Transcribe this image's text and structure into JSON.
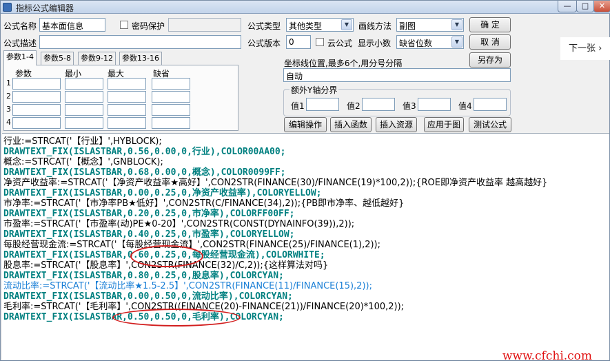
{
  "window": {
    "title": "指标公式编辑器",
    "minimize": "—",
    "maximize": "□",
    "close": "✕"
  },
  "form": {
    "name_label": "公式名称",
    "name_value": "基本面信息",
    "password_label": "密码保护",
    "desc_label": "公式描述",
    "desc_value": "",
    "type_label": "公式类型",
    "type_value": "其他类型",
    "draw_label": "画线方法",
    "draw_value": "副图",
    "version_label": "公式版本",
    "version_value": "0",
    "cloud_label": "云公式",
    "decimals_label": "显示小数",
    "decimals_value": "缺省位数"
  },
  "buttons": {
    "confirm": "确  定",
    "cancel": "取  消",
    "save_as": "另存为",
    "edit_op": "编辑操作",
    "insert_func": "插入函数",
    "insert_res": "插入资源",
    "apply_chart": "应用于图",
    "test_formula": "测试公式"
  },
  "tabs": [
    "参数1-4",
    "参数5-8",
    "参数9-12",
    "参数13-16"
  ],
  "params": {
    "col_param": "参数",
    "col_min": "最小",
    "col_max": "最大",
    "col_default": "缺省",
    "rows": [
      "1",
      "2",
      "3",
      "4"
    ]
  },
  "coord": {
    "label": "坐标线位置,最多6个,用分号分隔",
    "value": "自动"
  },
  "yaxis": {
    "legend": "额外Y轴分界",
    "v1": "值1",
    "v2": "值2",
    "v3": "值3",
    "v4": "值4"
  },
  "next_page": "下一张 ›",
  "code_lines": [
    "行业:=STRCAT('【行业】',HYBLOCK);",
    "DRAWTEXT_FIX(ISLASTBAR,0.56,0.00,0,行业),COLOR00AA00;",
    "概念:=STRCAT('【概念】',GNBLOCK);",
    "DRAWTEXT_FIX(ISLASTBAR,0.68,0.00,0,概念),COLOR0099FF;",
    "净资产收益率:=STRCAT('【净资产收益率★高好】',CON2STR(FINANCE(30)/FINANCE(19)*100,2));{ROE即净资产收益率 越高越好}",
    "DRAWTEXT_FIX(ISLASTBAR,0.00,0.25,0,净资产收益率),COLORYELLOW;",
    "市净率:=STRCAT('【市净率PB★低好】',CON2STR(C/FINANCE(34),2));{PB即市净率、越低越好}",
    "DRAWTEXT_FIX(ISLASTBAR,0.20,0.25,0,市净率),COLORFF00FF;",
    "市盈率:=STRCAT('【市盈率(动)PE★0-20】',CON2STR(CONST(DYNAINFO(39)),2));",
    "DRAWTEXT_FIX(ISLASTBAR,0.40,0.25,0,市盈率),COLORYELLOW;",
    "每股经营现金流:=STRCAT('【每股经营现金流】',CON2STR(FINANCE(25)/FINANCE(1),2));",
    "DRAWTEXT_FIX(ISLASTBAR,0.60,0.25,0,每股经营现金流),COLORWHITE;",
    "股息率:=STRCAT('【股息率】',CON2STR(FINANCE(32)/C,2));{这样算法对吗}",
    "DRAWTEXT_FIX(ISLASTBAR,0.80,0.25,0,股息率),COLORCYAN;",
    "流动比率:=STRCAT('【流动比率★1.5-2.5】',CON2STR(FINANCE(11)/FINANCE(15),2));",
    "DRAWTEXT_FIX(ISLASTBAR,0.00,0.50,0,流动比率),COLORCYAN;",
    "毛利率:=STRCAT('【毛利率】',CON2STR((FINANCE(20)-FINANCE(21))/FINANCE(20)*100,2));",
    "DRAWTEXT_FIX(ISLASTBAR,0.50,0.50,0,毛利率),COLORCYAN;"
  ],
  "watermark": "www.cfchi.com",
  "colors": {
    "keyword": "#008080",
    "comment": "#8080a0",
    "annotation": "#d21e1e",
    "watermark": "#e01010"
  }
}
